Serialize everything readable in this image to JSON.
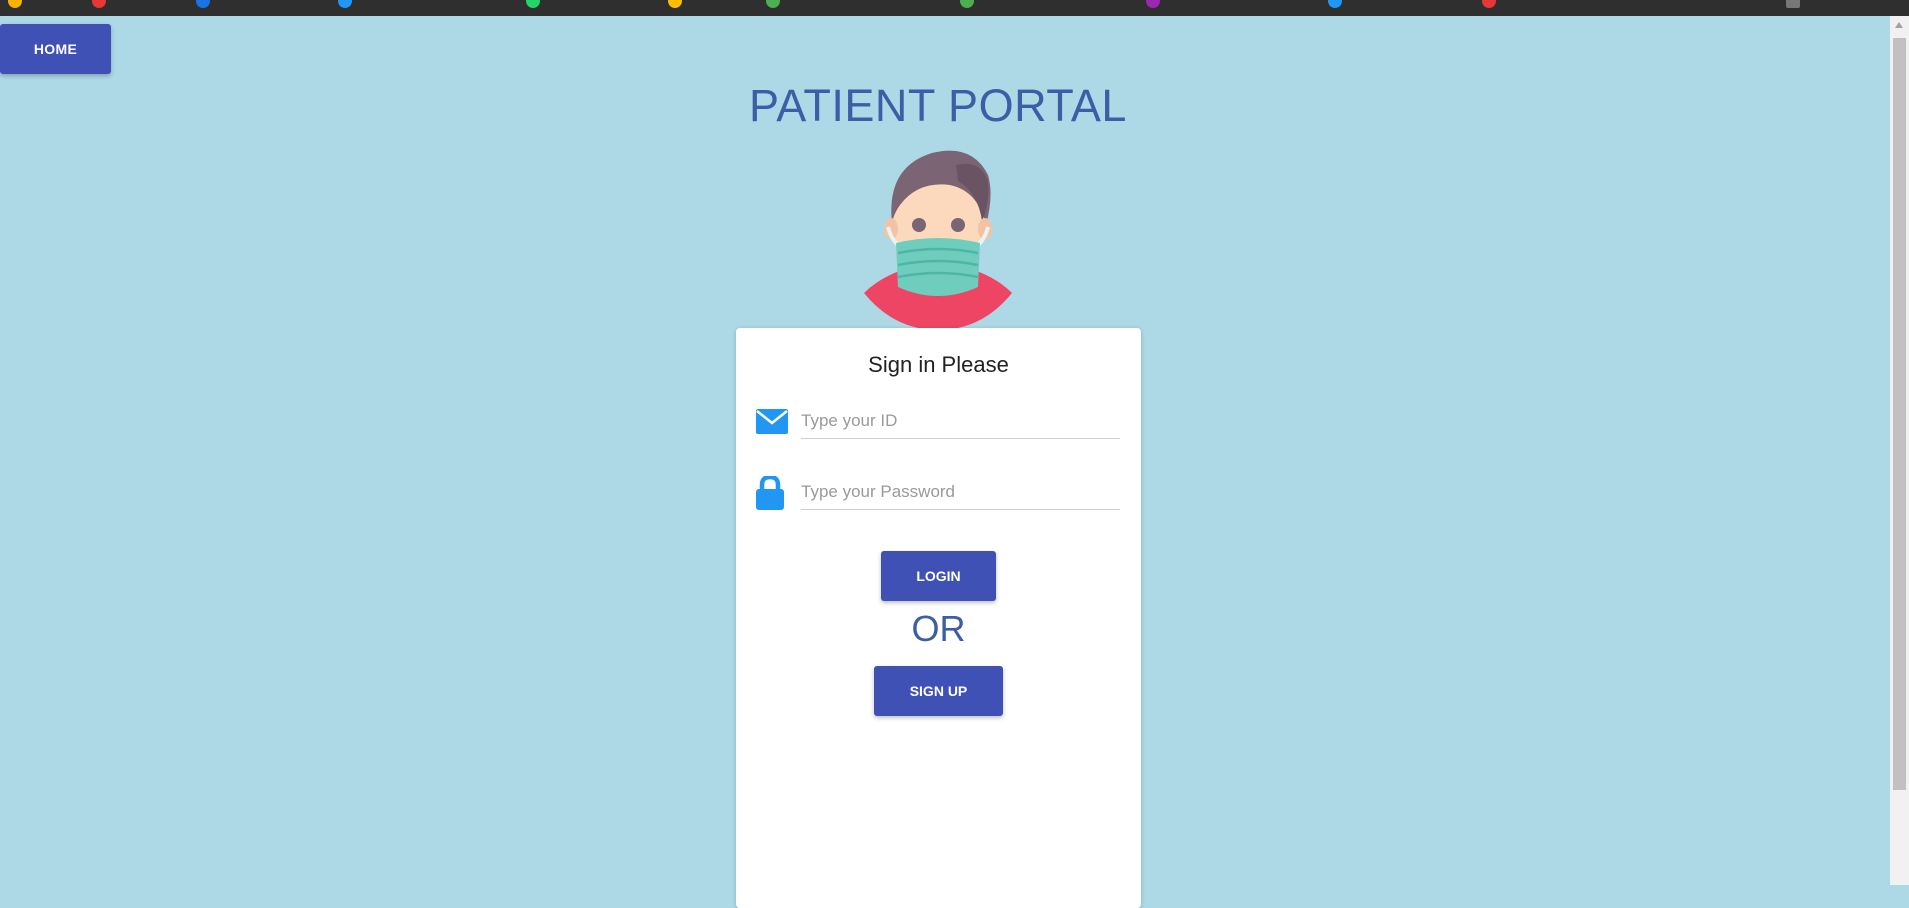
{
  "nav": {
    "home_label": "HOME"
  },
  "header": {
    "title": "PATIENT PORTAL"
  },
  "login_card": {
    "title": "Sign in Please",
    "id_placeholder": "Type your ID",
    "password_placeholder": "Type your Password",
    "login_label": "LOGIN",
    "or_text": "OR",
    "signup_label": "SIGN UP"
  },
  "icons": {
    "email": "envelope-icon",
    "password": "lock-icon",
    "avatar": "masked-patient-avatar"
  },
  "colors": {
    "background": "#add8e6",
    "primary_button": "#3f51b5",
    "title_text": "#3b5ea6",
    "icon_blue": "#2196f3"
  }
}
